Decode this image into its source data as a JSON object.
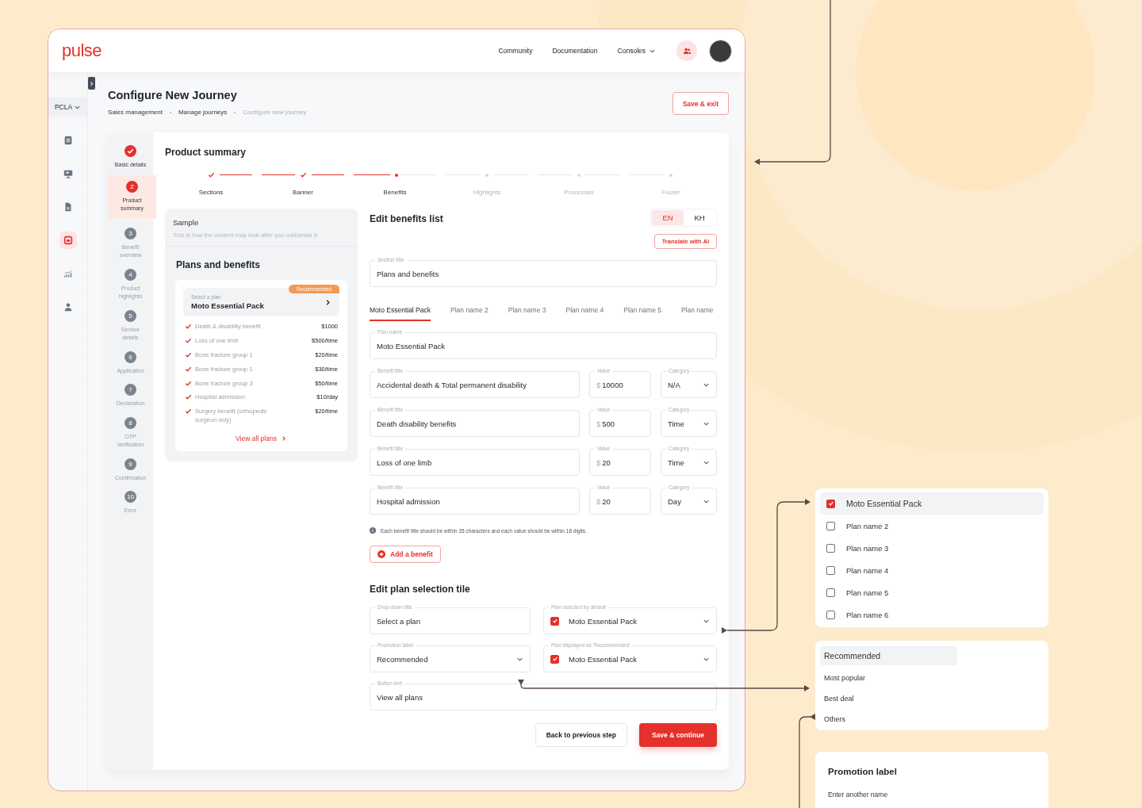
{
  "app": {
    "logo": "pulse",
    "nav": [
      {
        "label": "Community",
        "kind": "link"
      },
      {
        "label": "Documentation",
        "kind": "link"
      },
      {
        "label": "Consoles",
        "kind": "menu"
      }
    ],
    "region": "PCLA"
  },
  "rail_icons": [
    {
      "kind": "list",
      "selected": false
    },
    {
      "kind": "monitor",
      "selected": false
    },
    {
      "kind": "document",
      "selected": false
    },
    {
      "kind": "brand",
      "selected": true
    },
    {
      "kind": "chart",
      "selected": false
    },
    {
      "kind": "user",
      "selected": false
    }
  ],
  "page": {
    "title": "Configure New Journey",
    "breadcrumb": [
      {
        "label": "Sales management",
        "current": false
      },
      {
        "label": "Manage journeys",
        "current": false
      },
      {
        "label": "Configure new journey",
        "current": true
      }
    ],
    "save_exit": "Save & exit"
  },
  "steps": [
    {
      "label": "Basic details",
      "completed": true,
      "selected": false
    },
    {
      "number": "2",
      "label": "Product summary",
      "completed": false,
      "selected": true
    },
    {
      "number": "3",
      "label": "Benefit overview",
      "completed": false,
      "selected": false
    },
    {
      "number": "4",
      "label": "Product highlights",
      "completed": false,
      "selected": false
    },
    {
      "number": "5",
      "label": "Service details",
      "completed": false,
      "selected": false
    },
    {
      "number": "6",
      "label": "Application",
      "completed": false,
      "selected": false
    },
    {
      "number": "7",
      "label": "Declaration",
      "completed": false,
      "selected": false
    },
    {
      "number": "8",
      "label": "OTP verification",
      "completed": false,
      "selected": false
    },
    {
      "number": "9",
      "label": "Confirmation",
      "completed": false,
      "selected": false
    },
    {
      "number": "10",
      "label": "Error",
      "completed": false,
      "selected": false
    }
  ],
  "section": {
    "title": "Product summary",
    "substeps": [
      {
        "label": "Sections",
        "completed": true,
        "selected": false
      },
      {
        "label": "Banner",
        "completed": true,
        "selected": false
      },
      {
        "label": "Benefits",
        "completed": false,
        "selected": true
      },
      {
        "label": "Highlights",
        "completed": false,
        "selected": false
      },
      {
        "label": "Processes",
        "completed": false,
        "selected": false
      },
      {
        "label": "Footer",
        "completed": false,
        "selected": false
      }
    ]
  },
  "sample": {
    "title": "Sample",
    "subtitle": "This is how the content may look after you customise it.",
    "heading": "Plans and benefits",
    "select_label": "Select a plan",
    "select_value": "Moto Essential Pack",
    "badge": "Recommended",
    "benefits": [
      {
        "name": "Death & disability benefit",
        "amount": "$1000"
      },
      {
        "name": "Loss of one limb",
        "amount": "$500/time"
      },
      {
        "name": "Bone fracture group 1",
        "amount": "$20/time"
      },
      {
        "name": "Bone fracture group 1",
        "amount": "$30/time"
      },
      {
        "name": "Bone fracture group 3",
        "amount": "$50/time"
      },
      {
        "name": "Hospital admission",
        "amount": "$10/day"
      },
      {
        "name": "Surgery benefit (orthopedic surgeon only)",
        "amount": "$20/time"
      }
    ],
    "link": "View all plans"
  },
  "editor": {
    "title": "Edit benefits list",
    "languages": [
      {
        "label": "EN",
        "selected": true
      },
      {
        "label": "KH",
        "selected": false
      }
    ],
    "translate": "Translate with AI",
    "section_title": {
      "label": "Section title",
      "value": "Plans and benefits"
    },
    "plan_tabs": [
      {
        "label": "Moto Essential Pack",
        "selected": true
      },
      {
        "label": "Plan name 2",
        "selected": false
      },
      {
        "label": "Plan name 3",
        "selected": false
      },
      {
        "label": "Plan name 4",
        "selected": false
      },
      {
        "label": "Plan name 5",
        "selected": false
      },
      {
        "label": "Plan name",
        "selected": false
      }
    ],
    "plan_name": {
      "label": "Plan name",
      "value": "Moto Essential Pack"
    },
    "benefits": [
      {
        "title_label": "Benefit title",
        "title": "Accidental death & Total permanent disability",
        "value_label": "Value",
        "currency": "$",
        "value": "10000",
        "category_label": "Category",
        "category": "N/A"
      },
      {
        "title_label": "Benefit title",
        "title": "Death disability benefits",
        "value_label": "Value",
        "currency": "$",
        "value": "500",
        "category_label": "Category",
        "category": "Time"
      },
      {
        "title_label": "Benefit title",
        "title": "Loss of one limb",
        "value_label": "Value",
        "currency": "$",
        "value": "20",
        "category_label": "Category",
        "category": "Time"
      },
      {
        "title_label": "Benefit title",
        "title": "Hospital admission",
        "value_label": "Value",
        "currency": "$",
        "value": "20",
        "category_label": "Category",
        "category": "Day"
      }
    ],
    "note": "Each benefit title should be within 35 characters and each value should be within 18 digits.",
    "add_button": "Add a benefit"
  },
  "tile_editor": {
    "title": "Edit plan selection tile",
    "fields": [
      {
        "kind": "text",
        "label": "Drop-down title",
        "value": "Select a plan",
        "full_width": false
      },
      {
        "kind": "check-select",
        "label": "Plan selected by default",
        "value": "Moto Essential Pack",
        "checked": true,
        "full_width": false
      },
      {
        "kind": "select",
        "label": "Promotion label",
        "value": "Recommended",
        "full_width": false
      },
      {
        "kind": "check-select",
        "label": "Plan displayed as 'Recommended'",
        "value": "Moto Essential Pack",
        "checked": true,
        "full_width": false
      },
      {
        "kind": "text",
        "label": "Button text",
        "value": "View all plans",
        "full_width": true
      }
    ]
  },
  "actions": [
    {
      "label": "Back to previous step",
      "kind": "secondary"
    },
    {
      "label": "Save & continue",
      "kind": "primary"
    }
  ],
  "plan_dropdown": [
    {
      "label": "Moto Essential Pack",
      "checked": true,
      "selected": true
    },
    {
      "label": "Plan name 2",
      "checked": false,
      "selected": false
    },
    {
      "label": "Plan name 3",
      "checked": false,
      "selected": false
    },
    {
      "label": "Plan name 4",
      "checked": false,
      "selected": false
    },
    {
      "label": "Plan name 5",
      "checked": false,
      "selected": false
    },
    {
      "label": "Plan name 6",
      "checked": false,
      "selected": false
    }
  ],
  "promo_options": [
    {
      "label": "Recommended",
      "selected": true
    },
    {
      "label": "Most popular",
      "selected": false
    },
    {
      "label": "Best deal",
      "selected": false
    },
    {
      "label": "Others",
      "selected": false
    }
  ],
  "promo_card": {
    "title": "Promotion label",
    "text": "Enter another name"
  }
}
